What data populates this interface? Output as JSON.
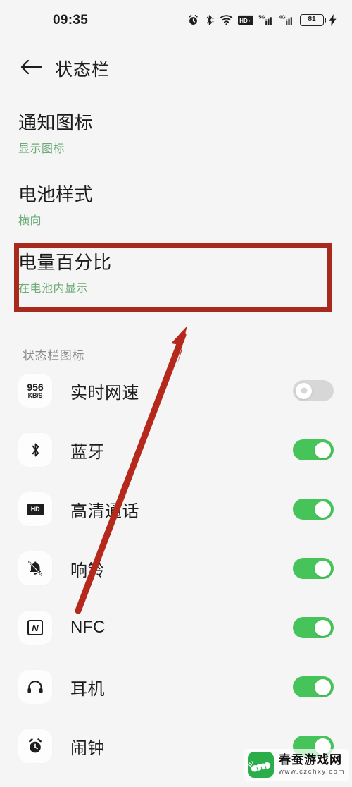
{
  "status_bar": {
    "time": "09:35",
    "battery_level": "81",
    "icons": [
      "alarm-icon",
      "bluetooth-icon",
      "wifi-icon",
      "hd-voice-icon",
      "signal-5g-icon",
      "signal-4g-icon",
      "battery-icon",
      "charging-bolt-icon"
    ]
  },
  "app_bar": {
    "back_label": "back-arrow",
    "title": "状态栏"
  },
  "settings": [
    {
      "title": "通知图标",
      "subtitle": "显示图标",
      "name": "notification-icons"
    },
    {
      "title": "电池样式",
      "subtitle": "横向",
      "name": "battery-style"
    },
    {
      "title": "电量百分比",
      "subtitle": "在电池内显示",
      "name": "battery-percentage",
      "highlighted": true
    }
  ],
  "section": {
    "label": "状态栏图标"
  },
  "toggle_rows": [
    {
      "label": "实时网速",
      "icon": "network-speed-icon",
      "icon_text_primary": "956",
      "icon_text_secondary": "KB/S",
      "state": "off"
    },
    {
      "label": "蓝牙",
      "icon": "bluetooth-icon",
      "state": "on"
    },
    {
      "label": "高清通话",
      "icon": "hd-icon",
      "icon_text": "HD",
      "state": "on"
    },
    {
      "label": "响铃",
      "icon": "bell-slash-icon",
      "state": "on"
    },
    {
      "label": "NFC",
      "icon": "nfc-icon",
      "icon_text": "N",
      "state": "on"
    },
    {
      "label": "耳机",
      "icon": "headphones-icon",
      "state": "on"
    },
    {
      "label": "闹钟",
      "icon": "alarm-clock-icon",
      "state": "on"
    }
  ],
  "annotation": {
    "box_color": "#a82a1f",
    "arrow_color": "#b5281c"
  },
  "watermark": {
    "site_name": "春蚕游戏网",
    "url": "www.czchxy.com"
  },
  "colors": {
    "background": "#f4f5f4",
    "toggle_on": "#46c45a",
    "toggle_off": "#d6d7d6",
    "subtitle_green": "#6aab76",
    "text_primary": "#1d1d1d",
    "text_muted": "#8a8d8a"
  }
}
